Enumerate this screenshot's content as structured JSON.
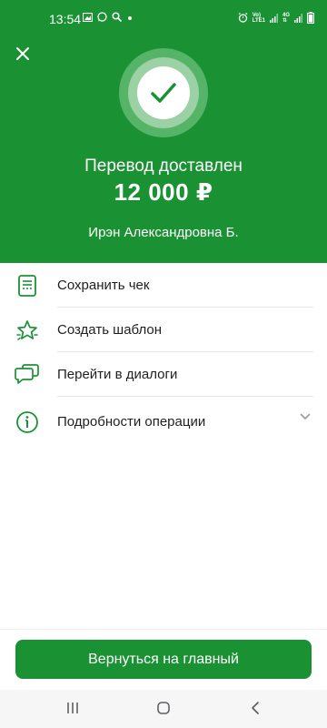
{
  "status_bar": {
    "time": "13:54",
    "network_top": "Vo)",
    "network_bottom": "LTE1",
    "data_top": "4G",
    "data_bottom": "⇅"
  },
  "header": {
    "title": "Перевод доставлен",
    "amount": "12 000 ₽",
    "recipient": "Ирэн Александровна Б."
  },
  "menu": {
    "items": [
      {
        "label": "Сохранить чек",
        "icon": "receipt-icon"
      },
      {
        "label": "Создать шаблон",
        "icon": "star-template-icon"
      },
      {
        "label": "Перейти в диалоги",
        "icon": "chat-icon"
      },
      {
        "label": "Подробности операции",
        "icon": "info-icon",
        "expandable": true
      }
    ]
  },
  "actions": {
    "home_button": "Вернуться на главный"
  },
  "colors": {
    "brand_green": "#1a9234",
    "text": "#1f1f22"
  }
}
